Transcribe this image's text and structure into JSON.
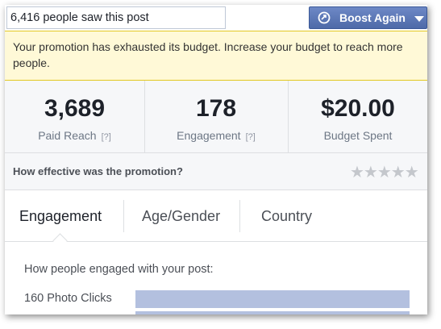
{
  "post": {
    "saw_text": "6,416 people saw this post"
  },
  "boost": {
    "label": "Boost Again",
    "icon": "rocket-icon"
  },
  "notice": {
    "text": "Your promotion has exhausted its budget. Increase your budget to reach more people."
  },
  "stats": [
    {
      "value": "3,689",
      "label": "Paid Reach",
      "help": "[?]"
    },
    {
      "value": "178",
      "label": "Engagement",
      "help": "[?]"
    },
    {
      "value": "$20.00",
      "label": "Budget Spent"
    }
  ],
  "rating": {
    "question": "How effective was the promotion?",
    "stars": "★★★★★",
    "rating_value": 0
  },
  "tabs": [
    {
      "label": "Engagement",
      "active": true
    },
    {
      "label": "Age/Gender"
    },
    {
      "label": "Country"
    }
  ],
  "engagement": {
    "heading": "How people engaged with your post:",
    "rows": [
      {
        "label": "160 Photo Clicks",
        "fraction": 1.0
      },
      {
        "label": "",
        "fraction": 1.0
      }
    ]
  },
  "colors": {
    "accent": "#4e6aa8",
    "notice_bg": "#fff9d7",
    "bar": "#b3c0df"
  }
}
